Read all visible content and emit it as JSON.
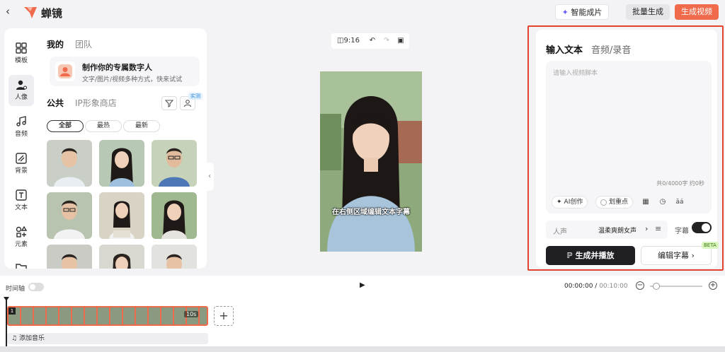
{
  "app": {
    "title": "蝉镜"
  },
  "topbar": {
    "smart_label": "智能成片",
    "batch_label": "批量生成",
    "generate_label": "生成视频"
  },
  "rail": {
    "items": [
      {
        "label": "模板",
        "icon": "grid-icon"
      },
      {
        "label": "人像",
        "icon": "person-icon"
      },
      {
        "label": "音频",
        "icon": "music-icon"
      },
      {
        "label": "背景",
        "icon": "background-icon"
      },
      {
        "label": "文本",
        "icon": "text-icon"
      },
      {
        "label": "元素",
        "icon": "elements-icon"
      }
    ]
  },
  "library": {
    "tabs": [
      "我的",
      "团队"
    ],
    "promo_title": "制作你的专属数字人",
    "promo_sub": "文字/图片/视频多种方式，快来试试",
    "subtabs": [
      "公共",
      "IP形象商店"
    ],
    "new_badge": "实测",
    "chips": [
      "全部",
      "最热",
      "最新"
    ]
  },
  "center": {
    "ratio": "9:16",
    "caption": "在右侧区域编辑文本字幕"
  },
  "right": {
    "tabs": [
      "输入文本",
      "音频/录音"
    ],
    "placeholder": "请输入视频脚本",
    "counter": "共0/4000字 约0秒",
    "ai_label": "AI创作",
    "emphasis_label": "划重点",
    "pinyin_label": "āá",
    "voice_label": "人声",
    "voice_value": "温柔爽朗女声",
    "subtitle_label": "字幕",
    "play_gen_label": "生成并播放",
    "edit_sub_label": "编辑字幕",
    "beta": "BETA"
  },
  "timeline": {
    "label": "时间轴",
    "time_current": "00:00:00",
    "time_total": "00:10:00",
    "clip_num": "1",
    "clip_duration": "10s",
    "add_music": "添加音乐"
  }
}
